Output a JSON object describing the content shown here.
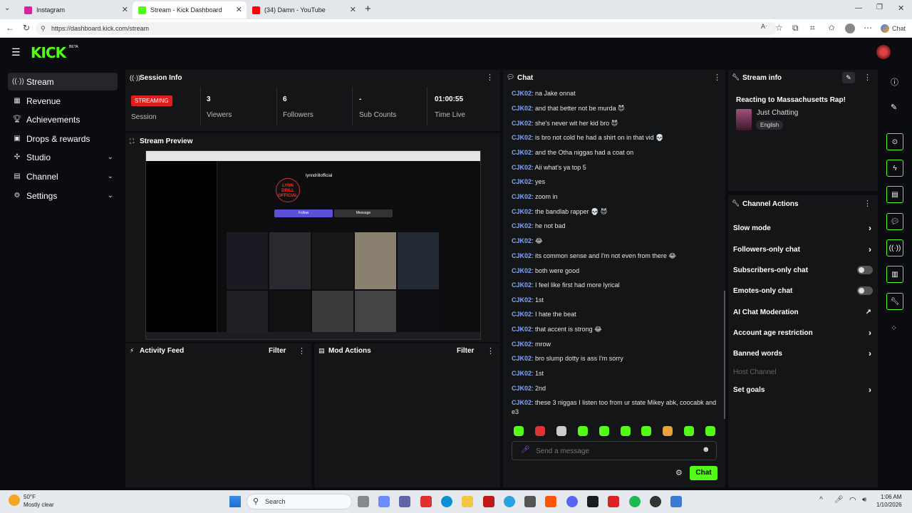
{
  "browser": {
    "tabs": [
      {
        "label": "Instagram",
        "color": "#d6249f"
      },
      {
        "label": "Stream - Kick Dashboard",
        "color": "#53fc18"
      },
      {
        "label": "(34) Damn - YouTube",
        "color": "#ff0000"
      }
    ],
    "url": "https://dashboard.kick.com/stream",
    "chat_btn": "Chat"
  },
  "brand": {
    "logo": "KICK",
    "beta": "BETA",
    "accent": "#53fc18"
  },
  "sidebar": {
    "items": [
      {
        "label": "Stream",
        "icon": "broadcast-icon"
      },
      {
        "label": "Revenue",
        "icon": "revenue-icon"
      },
      {
        "label": "Achievements",
        "icon": "trophy-icon"
      },
      {
        "label": "Drops & rewards",
        "icon": "gift-icon"
      },
      {
        "label": "Studio",
        "icon": "studio-icon"
      },
      {
        "label": "Channel",
        "icon": "channel-icon"
      },
      {
        "label": "Settings",
        "icon": "gear-icon"
      }
    ]
  },
  "session": {
    "title": "Session Info",
    "status": "STREAMING",
    "status_label": "Session",
    "viewers_value": "3",
    "viewers_label": "Viewers",
    "followers_value": "6",
    "followers_label": "Followers",
    "subs_value": "-",
    "subs_label": "Sub Counts",
    "time_value": "01:00:55",
    "time_label": "Time Live"
  },
  "preview": {
    "title": "Stream Preview",
    "profile_name": "lynndrillofficial",
    "logo_text": "LYNN DRILL OFFICIAL",
    "follow": "Follow",
    "message": "Message"
  },
  "activity": {
    "title": "Activity Feed",
    "filter": "Filter"
  },
  "mod": {
    "title": "Mod Actions",
    "filter": "Filter"
  },
  "chat": {
    "title": "Chat",
    "messages": [
      {
        "user": "CJK02",
        "text": "na Jake onnat"
      },
      {
        "user": "CJK02",
        "text": "and that better not be murda 😈"
      },
      {
        "user": "CJK02",
        "text": "she's never wit her kid bro 😈"
      },
      {
        "user": "CJK02",
        "text": "is bro not cold he had a shirt on in that vid 💀"
      },
      {
        "user": "CJK02",
        "text": "and the Otha niggas had a coat on"
      },
      {
        "user": "CJK02",
        "text": "Aii what's ya top 5"
      },
      {
        "user": "CJK02",
        "text": "yes"
      },
      {
        "user": "CJK02",
        "text": "zoom in"
      },
      {
        "user": "CJK02",
        "text": "the bandlab rapper 💀 😈"
      },
      {
        "user": "CJK02",
        "text": "he not bad"
      },
      {
        "user": "CJK02",
        "text": "😂"
      },
      {
        "user": "CJK02",
        "text": "its common sense and I'm not even from there 😂"
      },
      {
        "user": "CJK02",
        "text": "both were good"
      },
      {
        "user": "CJK02",
        "text": "I feel like first had more lyrical"
      },
      {
        "user": "CJK02",
        "text": "1st"
      },
      {
        "user": "CJK02",
        "text": "I hate the beat"
      },
      {
        "user": "CJK02",
        "text": "that accent is strong 😂"
      },
      {
        "user": "CJK02",
        "text": "mrow"
      },
      {
        "user": "CJK02",
        "text": "bro slump dotty is ass I'm sorry"
      },
      {
        "user": "CJK02",
        "text": "1st"
      },
      {
        "user": "CJK02",
        "text": "2nd"
      },
      {
        "user": "CJK02",
        "text": "these 3 niggas I listen too from ur state Mikey abk, coocabk and e3"
      }
    ],
    "placeholder": "Send a message",
    "send": "Chat"
  },
  "stream_info": {
    "title": "Stream info",
    "stream_title": "Reacting to Massachusetts Rap!",
    "category": "Just Chatting",
    "language": "English"
  },
  "channel_actions": {
    "title": "Channel Actions",
    "rows": [
      {
        "label": "Slow mode"
      },
      {
        "label": "Followers-only chat"
      },
      {
        "label": "Subscribers-only chat"
      },
      {
        "label": "Emotes-only chat"
      },
      {
        "label": "AI Chat Moderation"
      },
      {
        "label": "Account age restriction"
      },
      {
        "label": "Banned words"
      },
      {
        "label": "Host Channel"
      },
      {
        "label": "Set goals"
      }
    ]
  },
  "taskbar": {
    "weather_temp": "50°F",
    "weather_desc": "Mostly clear",
    "search": "Search",
    "time": "1:06 AM",
    "date": "1/10/2026"
  }
}
